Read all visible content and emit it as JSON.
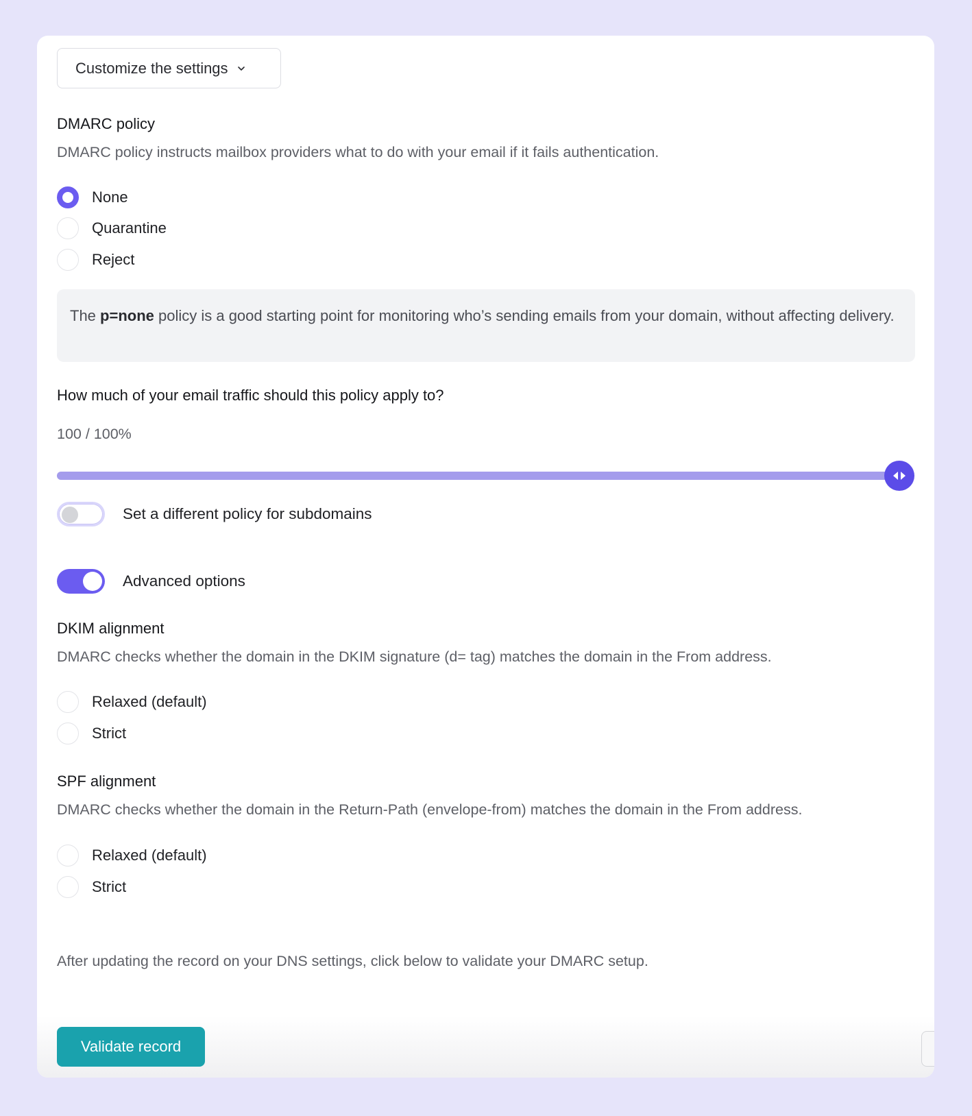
{
  "customize": {
    "label": "Customize the settings"
  },
  "policy": {
    "title": "DMARC policy",
    "description": "DMARC policy instructs mailbox providers what to do with your email if it fails authentication.",
    "options": [
      "None",
      "Quarantine",
      "Reject"
    ],
    "selected": "None",
    "info_prefix": "The ",
    "info_bold": "p=none",
    "info_suffix": " policy is a good starting point for monitoring who’s sending emails from your domain, without affecting delivery."
  },
  "traffic": {
    "question": "How much of your email traffic should this policy apply to?",
    "readout": "100 / 100%",
    "value_percent": 100
  },
  "subdomain_toggle": {
    "label": "Set a different policy for subdomains",
    "on": false
  },
  "advanced_toggle": {
    "label": "Advanced options",
    "on": true
  },
  "dkim": {
    "title": "DKIM alignment",
    "description": "DMARC checks whether the domain in the DKIM signature (d= tag) matches the domain in the From address.",
    "options": [
      "Relaxed (default)",
      "Strict"
    ]
  },
  "spf": {
    "title": "SPF alignment",
    "description": "DMARC checks whether the domain in the Return-Path (envelope-from) matches the domain in the From address.",
    "options": [
      "Relaxed (default)",
      "Strict"
    ]
  },
  "footer": {
    "note": "After updating the record on your DNS settings, click below to validate your DMARC setup.",
    "validate_label": "Validate record"
  },
  "colors": {
    "accent": "#6b5cf0",
    "slider_fill": "#a49cec",
    "validate": "#1aa2ad",
    "background": "#e6e4fa"
  },
  "icons": {
    "customize": "chevron-down-icon",
    "slider_thumb": "left-right-arrows-icon"
  }
}
